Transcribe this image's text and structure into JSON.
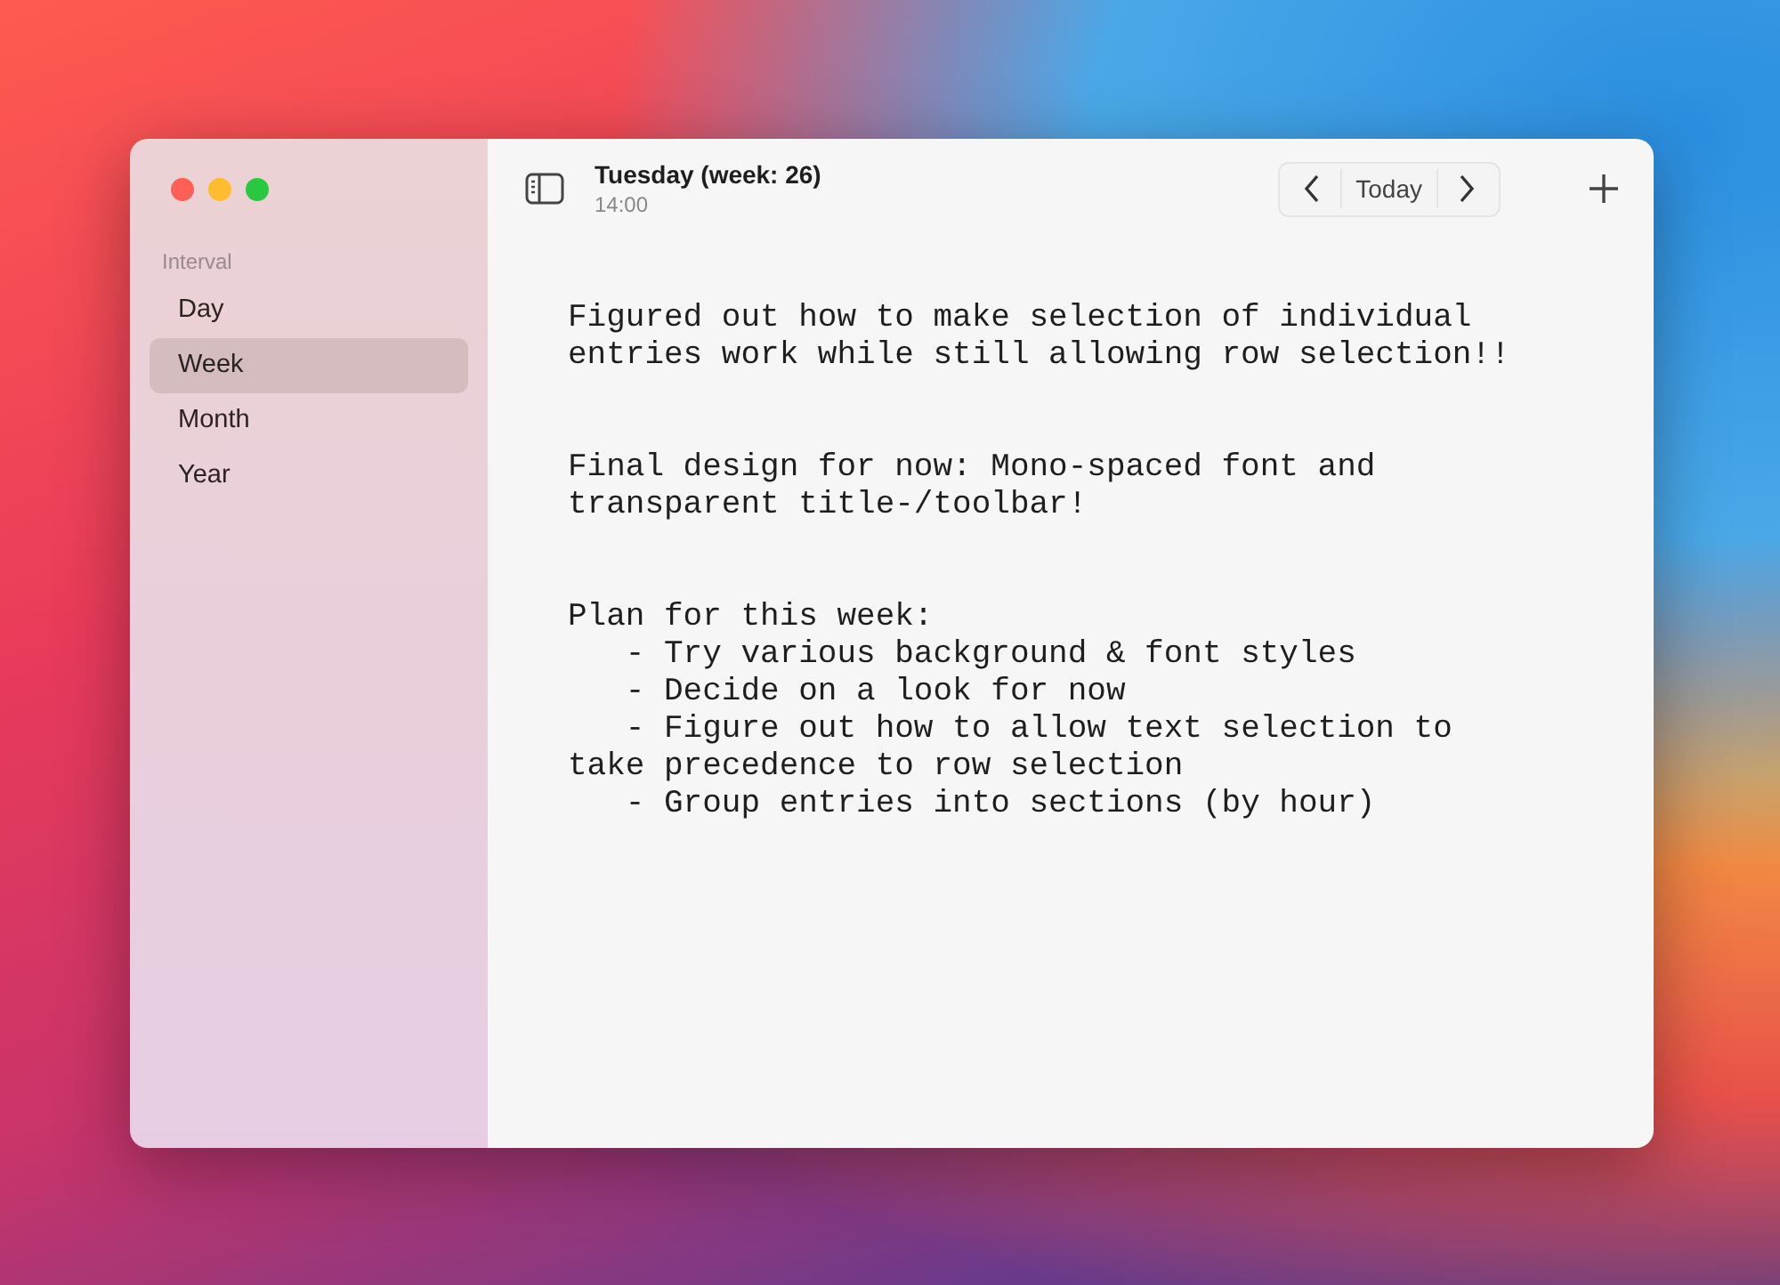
{
  "window": {
    "title": "Tuesday (week: 26)",
    "subtitle": "14:00"
  },
  "sidebar": {
    "heading": "Interval",
    "items": [
      {
        "label": "Day",
        "selected": false
      },
      {
        "label": "Week",
        "selected": true
      },
      {
        "label": "Month",
        "selected": false
      },
      {
        "label": "Year",
        "selected": false
      }
    ]
  },
  "toolbar": {
    "today_button": "Today"
  },
  "entries": [
    "Figured out how to make selection of individual entries work while still allowing row selection!!",
    "Final design for now: Mono-spaced font and transparent title-/toolbar!",
    "Plan for this week:\n   - Try various background & font styles\n   - Decide on a look for now\n   - Figure out how to allow text selection to take precedence to row selection\n   - Group entries into sections (by hour)"
  ]
}
